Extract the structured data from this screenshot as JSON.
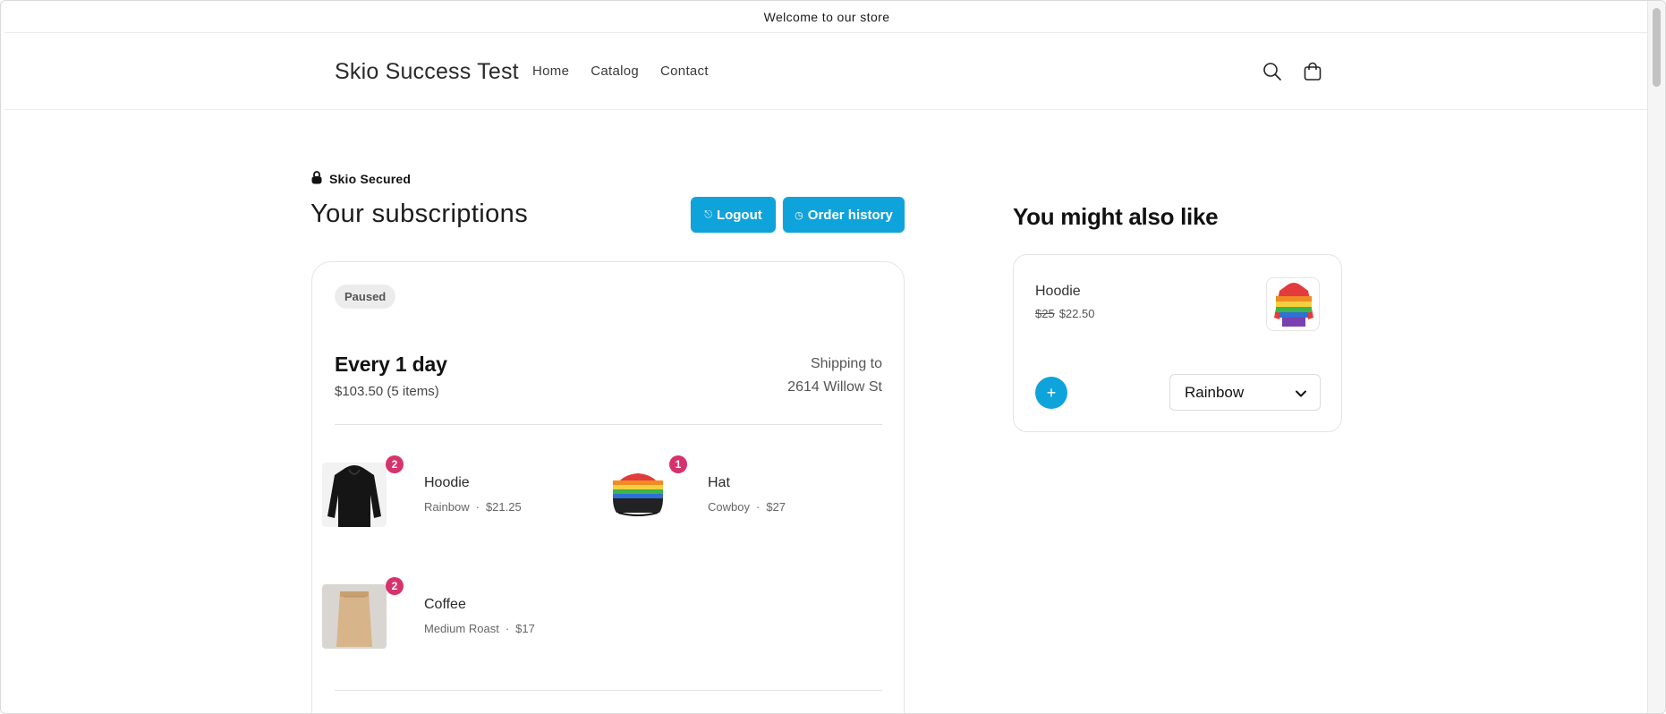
{
  "announcement": "Welcome to our store",
  "header": {
    "brand": "Skio Success Test",
    "nav": [
      "Home",
      "Catalog",
      "Contact"
    ]
  },
  "secured_label": "Skio Secured",
  "subscriptions": {
    "title": "Your subscriptions",
    "logout_label": "Logout",
    "order_history_label": "Order history",
    "status": "Paused",
    "frequency": "Every 1 day",
    "subtotal": "$103.50 (5 items)",
    "shipping_label": "Shipping to",
    "shipping_address": "2614 Willow St",
    "items": [
      {
        "qty": "2",
        "name": "Hoodie",
        "variant": "Rainbow",
        "price": "$21.25"
      },
      {
        "qty": "1",
        "name": "Hat",
        "variant": "Cowboy",
        "price": "$27"
      },
      {
        "qty": "2",
        "name": "Coffee",
        "variant": "Medium Roast",
        "price": "$17"
      }
    ]
  },
  "upsell": {
    "title": "You might also like",
    "product_name": "Hoodie",
    "original_price": "$25",
    "sale_price": "$22.50",
    "add_label": "+",
    "variant": "Rainbow"
  },
  "colors": {
    "accent": "#0fa3dc",
    "qty_badge": "#d6336c",
    "status_badge_bg": "#ececec"
  },
  "icons": [
    "search-icon",
    "cart-icon",
    "lock-icon",
    "logout-icon",
    "history-icon",
    "chevron-down-icon"
  ]
}
